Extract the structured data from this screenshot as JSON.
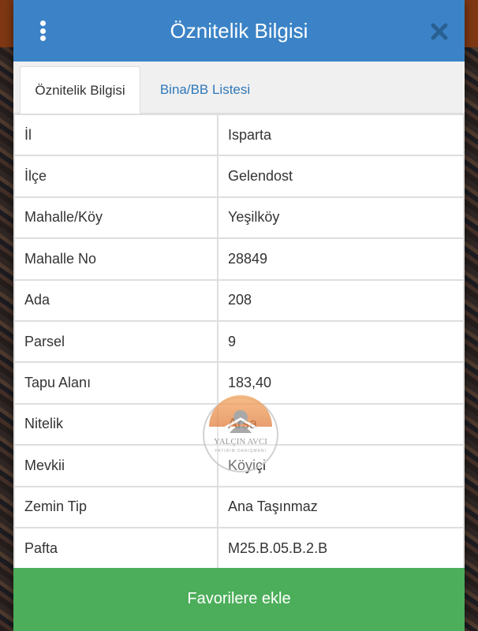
{
  "header": {
    "title": "Öznitelik Bilgisi"
  },
  "tabs": [
    {
      "label": "Öznitelik Bilgisi",
      "active": true
    },
    {
      "label": "Bina/BB Listesi",
      "active": false
    }
  ],
  "attributes": [
    {
      "key": "İl",
      "value": "Isparta"
    },
    {
      "key": "İlçe",
      "value": "Gelendost"
    },
    {
      "key": "Mahalle/Köy",
      "value": "Yeşilköy"
    },
    {
      "key": "Mahalle No",
      "value": "28849"
    },
    {
      "key": "Ada",
      "value": "208"
    },
    {
      "key": "Parsel",
      "value": "9"
    },
    {
      "key": "Tapu Alanı",
      "value": "183,40"
    },
    {
      "key": "Nitelik",
      "value": "Arsa"
    },
    {
      "key": "Mevkii",
      "value": "Köyiçi"
    },
    {
      "key": "Zemin Tip",
      "value": "Ana Taşınmaz"
    },
    {
      "key": "Pafta",
      "value": "M25.B.05.B.2.B"
    }
  ],
  "watermark": {
    "name": "YALÇIN AVCI",
    "subtitle": "YATIRIM DANIŞMANI"
  },
  "actions": {
    "favorite_label": "Favorilere ekle"
  },
  "colors": {
    "header": "#3b83c6",
    "tab_link": "#2f78b8",
    "favorite_button": "#4cae5a"
  },
  "icons": {
    "menu": "kebab-menu-icon",
    "close": "close-icon"
  }
}
